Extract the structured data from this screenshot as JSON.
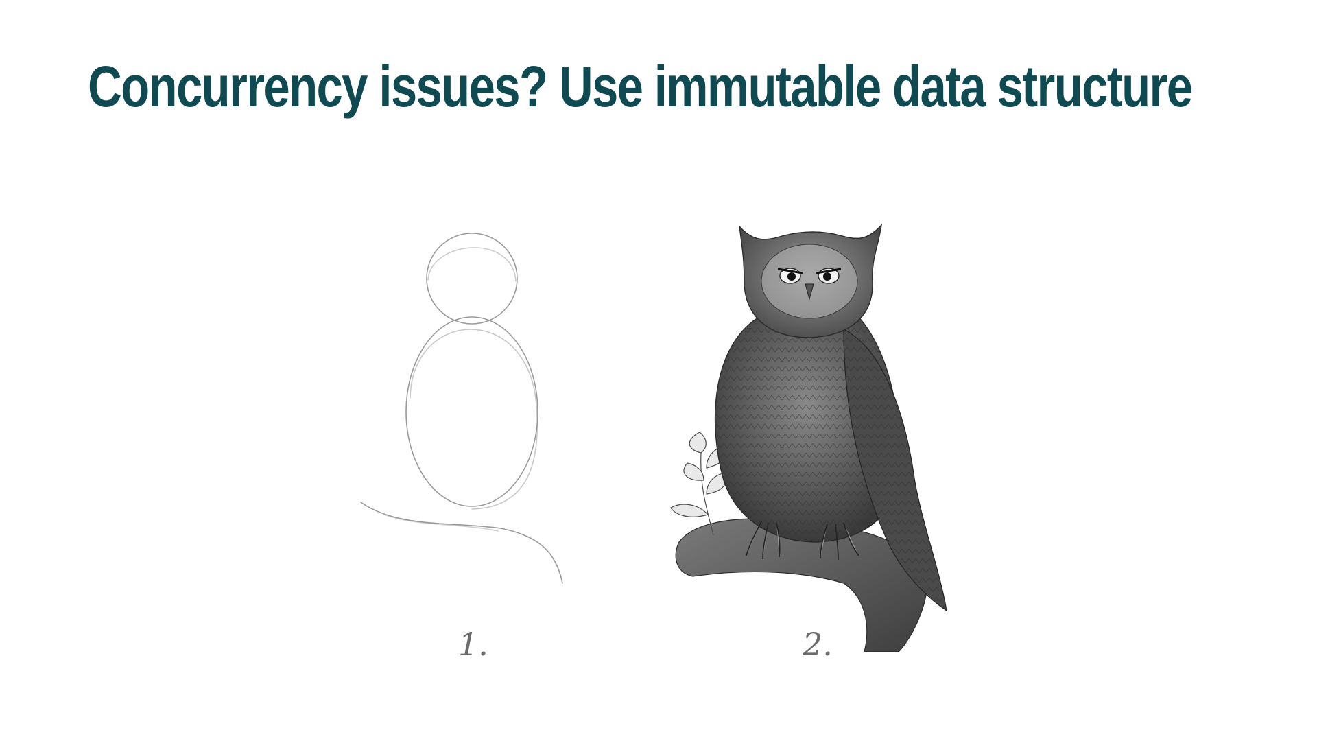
{
  "slide": {
    "title": "Concurrency issues? Use immutable data structure"
  },
  "illustration": {
    "step_1_label": "1.",
    "step_2_label": "2."
  }
}
